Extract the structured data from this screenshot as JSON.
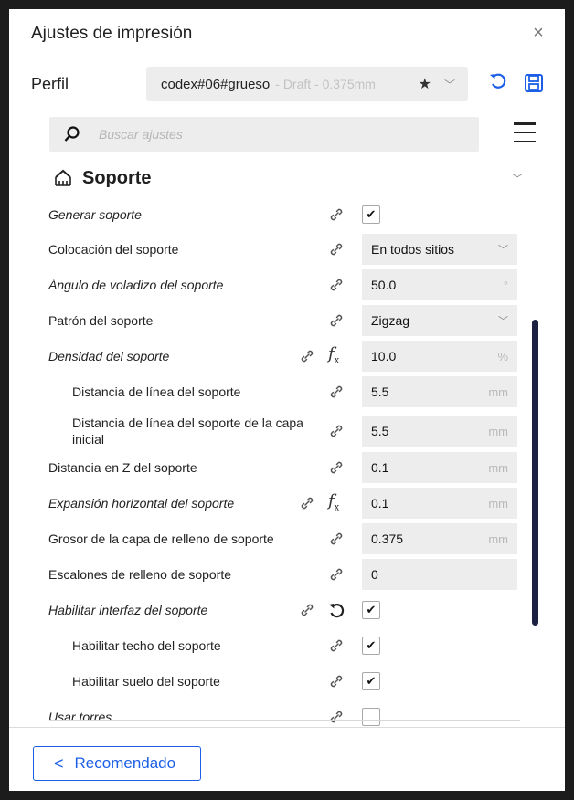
{
  "window": {
    "title": "Ajustes de impresión",
    "close": "×"
  },
  "profile": {
    "label": "Perfil",
    "name": "codex#06#grueso",
    "detail": "- Draft - 0.375mm"
  },
  "search": {
    "placeholder": "Buscar ajustes"
  },
  "section": {
    "title": "Soporte"
  },
  "settings": [
    {
      "label": "Generar soporte",
      "checked": "✔"
    },
    {
      "label": "Colocación del soporte",
      "value": "En todos sitios"
    },
    {
      "label": "Ángulo de voladizo del soporte",
      "value": "50.0",
      "unit": "°"
    },
    {
      "label": "Patrón del soporte",
      "value": "Zigzag"
    },
    {
      "label": "Densidad del soporte",
      "value": "10.0",
      "unit": "%"
    },
    {
      "label": "Distancia de línea del soporte",
      "value": "5.5",
      "unit": "mm"
    },
    {
      "label": "Distancia de línea del soporte de la capa inicial",
      "value": "5.5",
      "unit": "mm"
    },
    {
      "label": "Distancia en Z del soporte",
      "value": "0.1",
      "unit": "mm"
    },
    {
      "label": "Expansión horizontal del soporte",
      "value": "0.1",
      "unit": "mm"
    },
    {
      "label": "Grosor de la capa de relleno de soporte",
      "value": "0.375",
      "unit": "mm"
    },
    {
      "label": "Escalones de relleno de soporte",
      "value": "0"
    },
    {
      "label": "Habilitar interfaz del soporte",
      "checked": "✔"
    },
    {
      "label": "Habilitar techo del soporte",
      "checked": "✔"
    },
    {
      "label": "Habilitar suelo del soporte",
      "checked": "✔"
    },
    {
      "label": "Usar torres",
      "checked": ""
    }
  ],
  "footer": {
    "recommended": "Recomendado"
  },
  "colors": {
    "accent": "#1c5fe6",
    "scrollbar": "#1b2140",
    "field_bg": "#ededed"
  },
  "icons": [
    "close-icon",
    "star-icon",
    "chevron-down-icon",
    "reset-icon",
    "save-icon",
    "search-icon",
    "menu-icon",
    "support-icon",
    "link-icon",
    "function-icon",
    "checkbox-icon",
    "chevron-left-icon"
  ]
}
